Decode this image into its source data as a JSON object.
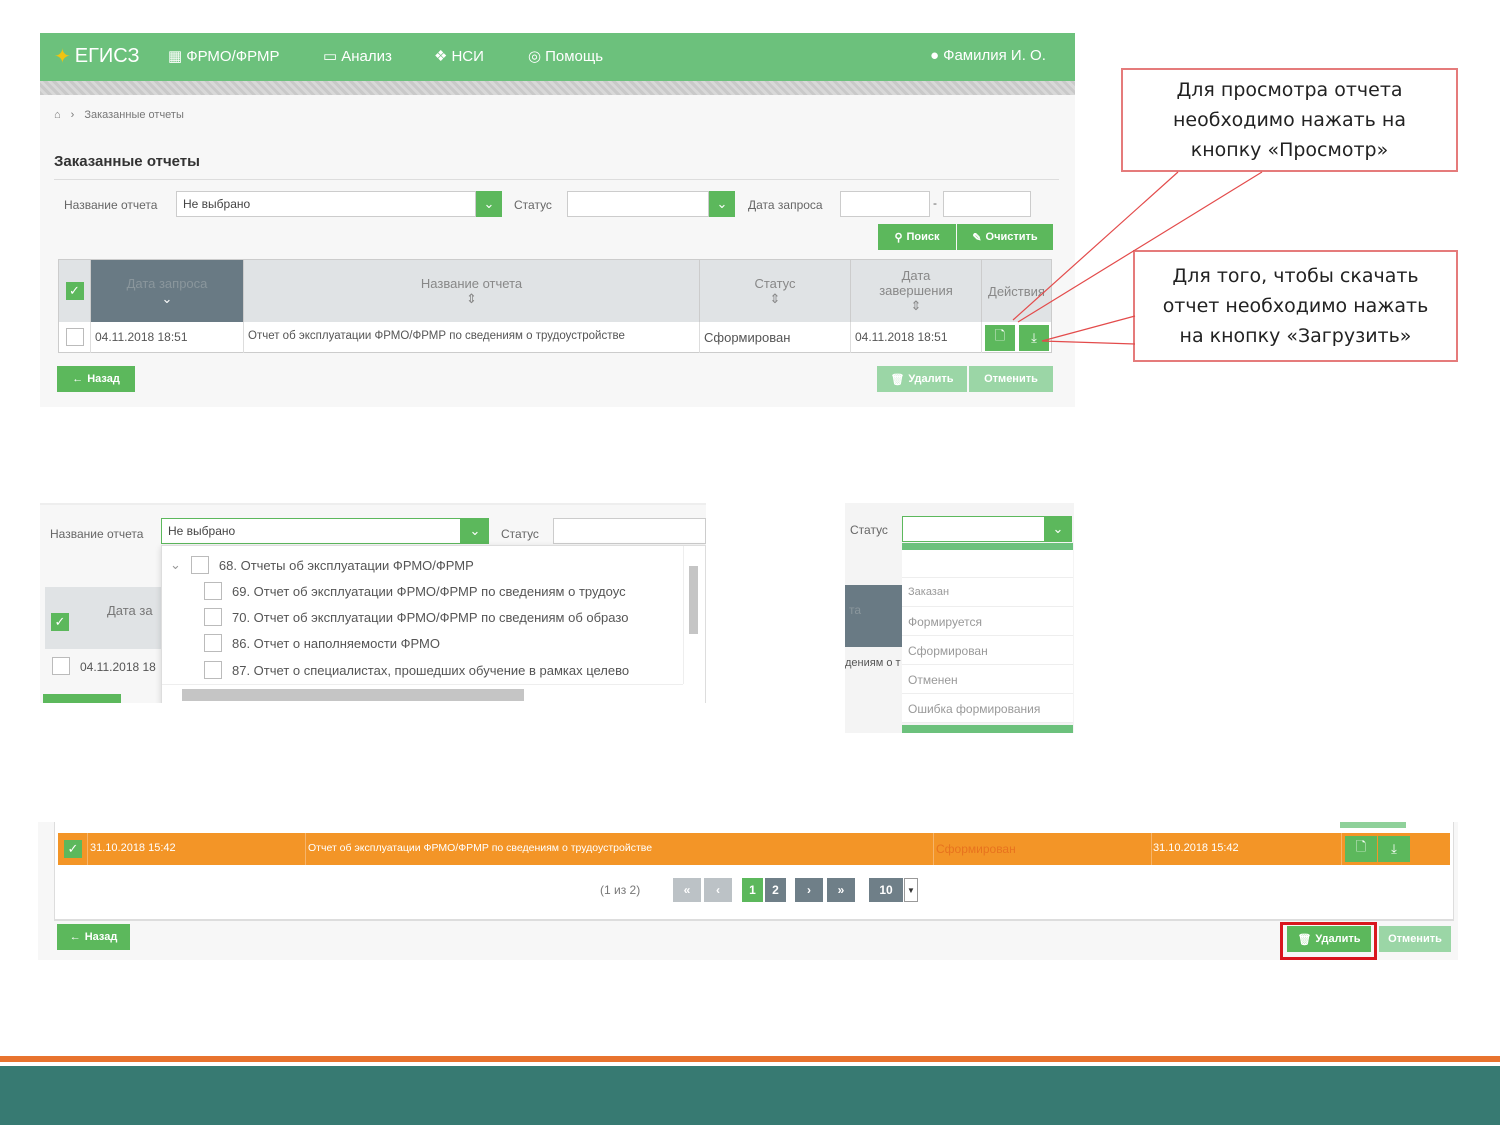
{
  "app": {
    "logo": "ЕГИСЗ",
    "nav": [
      "ФРМО/ФРМР",
      "Анализ",
      "НСИ",
      "Помощь"
    ],
    "user": "Фамилия И. О."
  },
  "breadcrumb": {
    "current": "Заказанные отчеты"
  },
  "page_title": "Заказанные отчеты",
  "filters": {
    "report_name_label": "Название отчета",
    "report_name_value": "Не выбрано",
    "status_label": "Статус",
    "status_value": "",
    "date_label": "Дата запроса",
    "date_sep": "-",
    "search_btn": "Поиск",
    "clear_btn": "Очистить"
  },
  "table": {
    "headers": [
      "Дата запроса",
      "Название отчета",
      "Статус",
      "Дата завершения",
      "Действия"
    ],
    "rows": [
      {
        "date": "04.11.2018 18:51",
        "name": "Отчет об эксплуатации ФРМО/ФРМР по сведениям о трудоустройстве",
        "status": "Сформирован",
        "end": "04.11.2018 18:51"
      }
    ]
  },
  "buttons": {
    "back": "Назад",
    "delete": "Удалить",
    "cancel": "Отменить"
  },
  "callouts": {
    "view": "Для просмотра отчета\nнеобходимо нажать на\nкнопку «Просмотр»",
    "download": "Для того, чтобы скачать\nотчет необходимо нажать\nна кнопку «Загрузить»"
  },
  "dropdown": {
    "label": "Название отчета",
    "value": "Не выбрано",
    "status_label": "Статус",
    "group": "68. Отчеты об эксплуатации ФРМО/ФРМР",
    "items": [
      "69. Отчет об эксплуатации ФРМО/ФРМР по сведениям о трудоус",
      "70. Отчет об эксплуатации ФРМО/ФРМР по сведениям об образо",
      "86. Отчет о наполняемости ФРМО",
      "87. Отчет о специалистах, прошедших обучение в рамках целево"
    ],
    "bg_header": "Дата за",
    "bg_date": "04.11.2018 18"
  },
  "status_dropdown": {
    "label": "Статус",
    "options": [
      "Заказан",
      "Формируется",
      "Сформирован",
      "Отменен",
      "Ошибка формирования"
    ],
    "bg_header": "та",
    "bg_text": "дениям о т"
  },
  "screen4": {
    "row": {
      "date": "31.10.2018 15:42",
      "name": "Отчет об эксплуатации ФРМО/ФРМР по сведениям о трудоустройстве",
      "status": "Сформирован",
      "end": "31.10.2018 15:42"
    },
    "pager_info": "(1 из 2)",
    "pages": [
      "1",
      "2"
    ],
    "page_size": "10"
  },
  "colors": {
    "green": "#5cb85c",
    "topbar": "#6cc17c",
    "orange": "#f39527",
    "footer": "#377a72",
    "footer_line": "#e8732e",
    "highlight": "#d9161e"
  }
}
